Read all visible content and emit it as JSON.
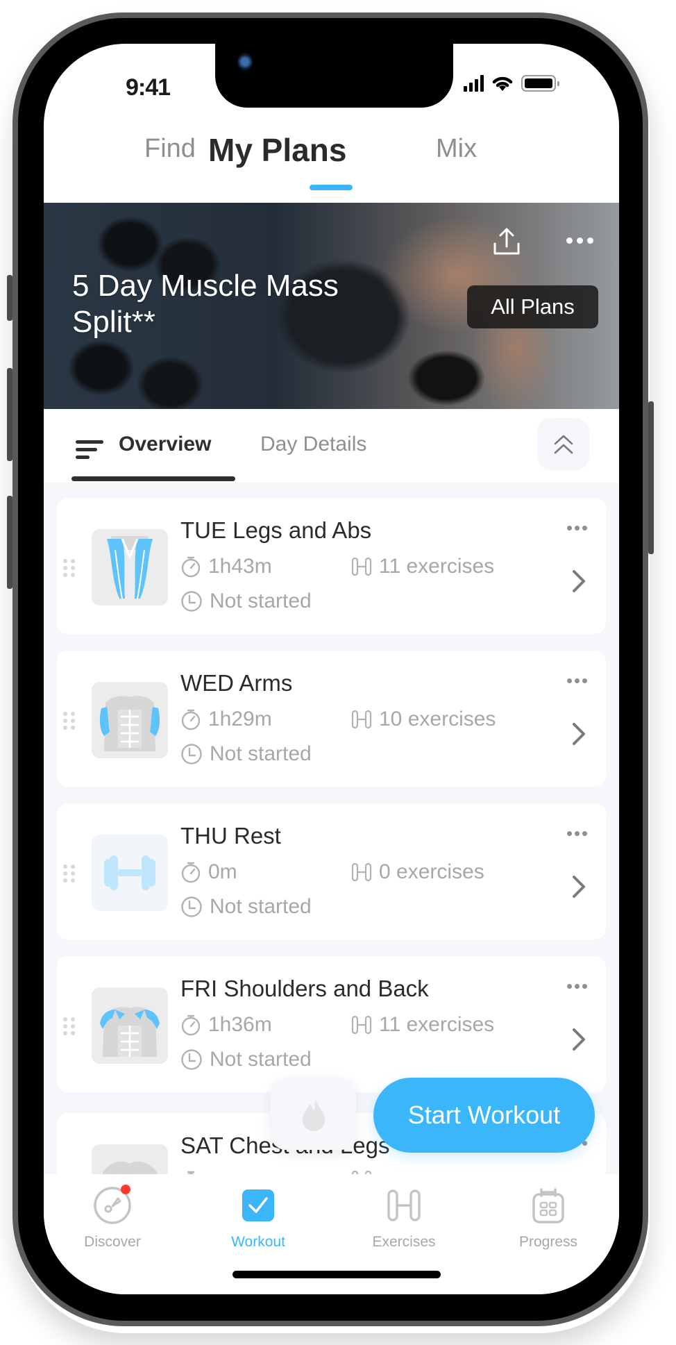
{
  "status_bar": {
    "time": "9:41"
  },
  "top_tabs": [
    {
      "label": "Find",
      "active": false
    },
    {
      "label": "My Plans",
      "active": true
    },
    {
      "label": "Mix",
      "active": false
    }
  ],
  "hero": {
    "title": "5 Day Muscle Mass Split**",
    "all_plans_label": "All Plans",
    "share_icon": "share-icon",
    "more_icon": "more-horizontal-icon"
  },
  "segment": {
    "tabs": [
      {
        "label": "Overview",
        "active": true
      },
      {
        "label": "Day Details",
        "active": false
      }
    ],
    "collapse_icon": "double-chevron-up-icon"
  },
  "days": [
    {
      "title": "TUE Legs and Abs",
      "duration": "1h43m",
      "exercises": "11 exercises",
      "status": "Not started",
      "thumb": "legs"
    },
    {
      "title": "WED Arms",
      "duration": "1h29m",
      "exercises": "10 exercises",
      "status": "Not started",
      "thumb": "arms"
    },
    {
      "title": "THU Rest",
      "duration": "0m",
      "exercises": "0 exercises",
      "status": "Not started",
      "thumb": "rest"
    },
    {
      "title": "FRI Shoulders and Back",
      "duration": "1h36m",
      "exercises": "11 exercises",
      "status": "Not started",
      "thumb": "shoulders"
    },
    {
      "title": "SAT Chest and Legs",
      "duration": "",
      "exercises": "",
      "status": "",
      "thumb": "chest"
    }
  ],
  "actions": {
    "start_workout_label": "Start Workout",
    "flame_icon": "flame-icon"
  },
  "tabbar": [
    {
      "label": "Discover",
      "icon": "compass-icon",
      "active": false,
      "badge": true
    },
    {
      "label": "Workout",
      "icon": "checkbox-icon",
      "active": true,
      "badge": false
    },
    {
      "label": "Exercises",
      "icon": "dumbbell-icon",
      "active": false,
      "badge": false
    },
    {
      "label": "Progress",
      "icon": "calendar-icon",
      "active": false,
      "badge": false
    }
  ],
  "colors": {
    "accent": "#3bb6fb",
    "muscle_highlight": "#5ec2fb",
    "badge_red": "#ff3b30",
    "text_primary": "#2b2b2b",
    "text_secondary": "#a7a7aa"
  }
}
